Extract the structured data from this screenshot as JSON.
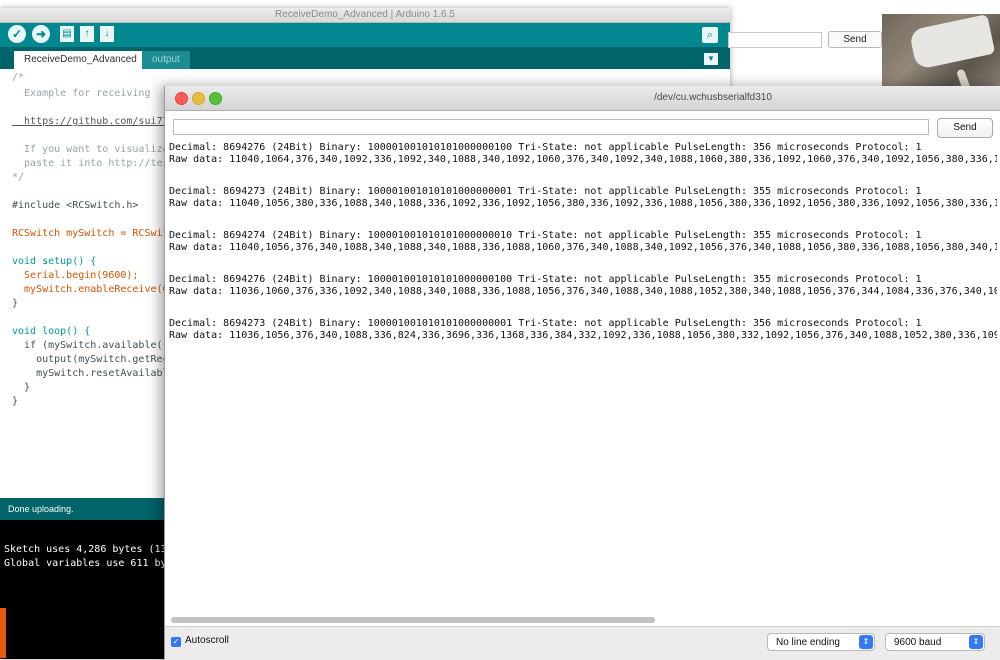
{
  "ide": {
    "title": "ReceiveDemo_Advanced | Arduino 1.6.5",
    "tabs": [
      {
        "label": "ReceiveDemo_Advanced"
      },
      {
        "label": "output"
      }
    ],
    "toolbar": {
      "verify_icon": "check-icon",
      "upload_icon": "arrow-right-icon",
      "new_icon": "file-icon",
      "open_icon": "arrow-up-icon",
      "save_icon": "arrow-down-icon",
      "serial_icon": "magnifier-icon"
    },
    "code_lines": [
      "/*",
      "  Example for receiving",
      "",
      "  https://github.com/sui77",
      "",
      "  If you want to visualize",
      "  paste it into http://tes",
      "*/",
      "",
      "#include <RCSwitch.h>",
      "",
      "RCSwitch mySwitch = RCSwit",
      "",
      "void setup() {",
      "  Serial.begin(9600);",
      "  mySwitch.enableReceive(0",
      "}",
      "",
      "void loop() {",
      "  if (mySwitch.available()",
      "    output(mySwitch.getRec",
      "    mySwitch.resetAvailabl",
      "  }",
      "}"
    ],
    "status": "Done uploading.",
    "console_lines": [
      "Sketch uses 4,286 bytes (13",
      "Global variables use 611 by"
    ]
  },
  "bg_serial": {
    "send_label": "Send"
  },
  "serial_monitor": {
    "title": "/dev/cu.wchusbserialfd310",
    "send_label": "Send",
    "input_value": "",
    "output_lines": [
      "Decimal: 8694276 (24Bit) Binary: 100001001010101000000100 Tri-State: not applicable PulseLength: 356 microseconds Protocol: 1",
      "Raw data: 11040,1064,376,340,1092,336,1092,340,1088,340,1092,1060,376,340,1092,340,1088,1060,380,336,1092,1060,376,340,1092,1056,380,336,10",
      "",
      "Decimal: 8694273 (24Bit) Binary: 100001001010101000000001 Tri-State: not applicable PulseLength: 355 microseconds Protocol: 1",
      "Raw data: 11040,1056,380,336,1088,340,1088,336,1092,336,1092,1056,380,336,1092,336,1088,1056,380,336,1092,1056,380,336,1092,1056,380,336,10",
      "",
      "Decimal: 8694274 (24Bit) Binary: 100001001010101000000010 Tri-State: not applicable PulseLength: 355 microseconds Protocol: 1",
      "Raw data: 11040,1056,376,340,1088,340,1088,340,1088,336,1088,1060,376,340,1088,340,1092,1056,376,340,1088,1056,380,336,1088,1056,380,340,10",
      "",
      "Decimal: 8694276 (24Bit) Binary: 100001001010101000000100 Tri-State: not applicable PulseLength: 355 microseconds Protocol: 1",
      "Raw data: 11036,1060,376,336,1092,340,1088,340,1088,336,1088,1056,376,340,1088,340,1088,1052,380,340,1088,1056,376,344,1084,336,376,340,10",
      "",
      "Decimal: 8694273 (24Bit) Binary: 100001001010101000000001 Tri-State: not applicable PulseLength: 356 microseconds Protocol: 1",
      "Raw data: 11036,1056,376,340,1088,336,824,336,3696,336,1368,336,384,332,1092,336,1088,1056,380,332,1092,1056,376,340,1088,1052,380,336,109"
    ],
    "autoscroll_label": "Autoscroll",
    "autoscroll_checked": true,
    "line_ending": "No line ending",
    "baud": "9600 baud"
  }
}
